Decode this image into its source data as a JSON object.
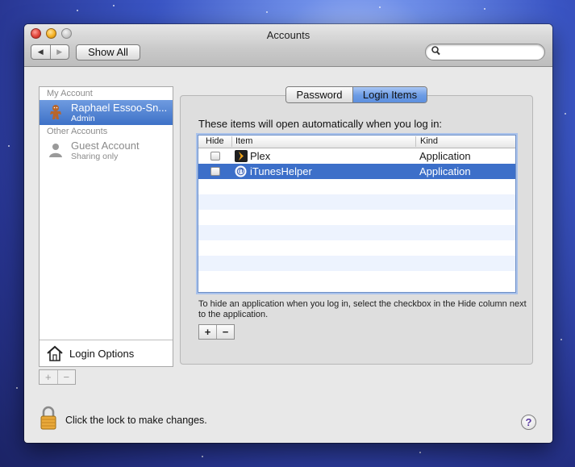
{
  "window": {
    "title": "Accounts",
    "nav": {
      "back_icon": "back-arrow-icon",
      "forward_icon": "forward-arrow-icon"
    },
    "show_all_label": "Show All",
    "search": {
      "placeholder": "",
      "icon": "magnifier-icon"
    }
  },
  "sidebar": {
    "my_account_header": "My Account",
    "my_account": {
      "name": "Raphael Essoo-Sn...",
      "role": "Admin",
      "selected": true
    },
    "other_accounts_header": "Other Accounts",
    "guest": {
      "name": "Guest Account",
      "status": "Sharing only"
    },
    "login_options_label": "Login Options",
    "add_label": "+",
    "remove_label": "−"
  },
  "tabs": [
    {
      "label": "Password",
      "selected": false
    },
    {
      "label": "Login Items",
      "selected": true
    }
  ],
  "login_items": {
    "intro": "These items will open automatically when you log in:",
    "columns": {
      "hide": "Hide",
      "item": "Item",
      "kind": "Kind"
    },
    "rows": [
      {
        "hide": false,
        "icon": "plex-icon",
        "name": "Plex",
        "kind": "Application",
        "selected": false
      },
      {
        "hide": false,
        "icon": "itunes-helper-icon",
        "name": "iTunesHelper",
        "kind": "Application",
        "selected": true
      }
    ],
    "hint": "To hide an application when you log in, select the checkbox in the Hide column next to the application.",
    "add_label": "+",
    "remove_label": "−"
  },
  "footer": {
    "lock_label": "Click the lock to make changes.",
    "help_label": "?"
  },
  "colors": {
    "selection": "#3c6fc9",
    "alt_row": "#edf3fe",
    "window_bg": "#e8e8e8"
  }
}
